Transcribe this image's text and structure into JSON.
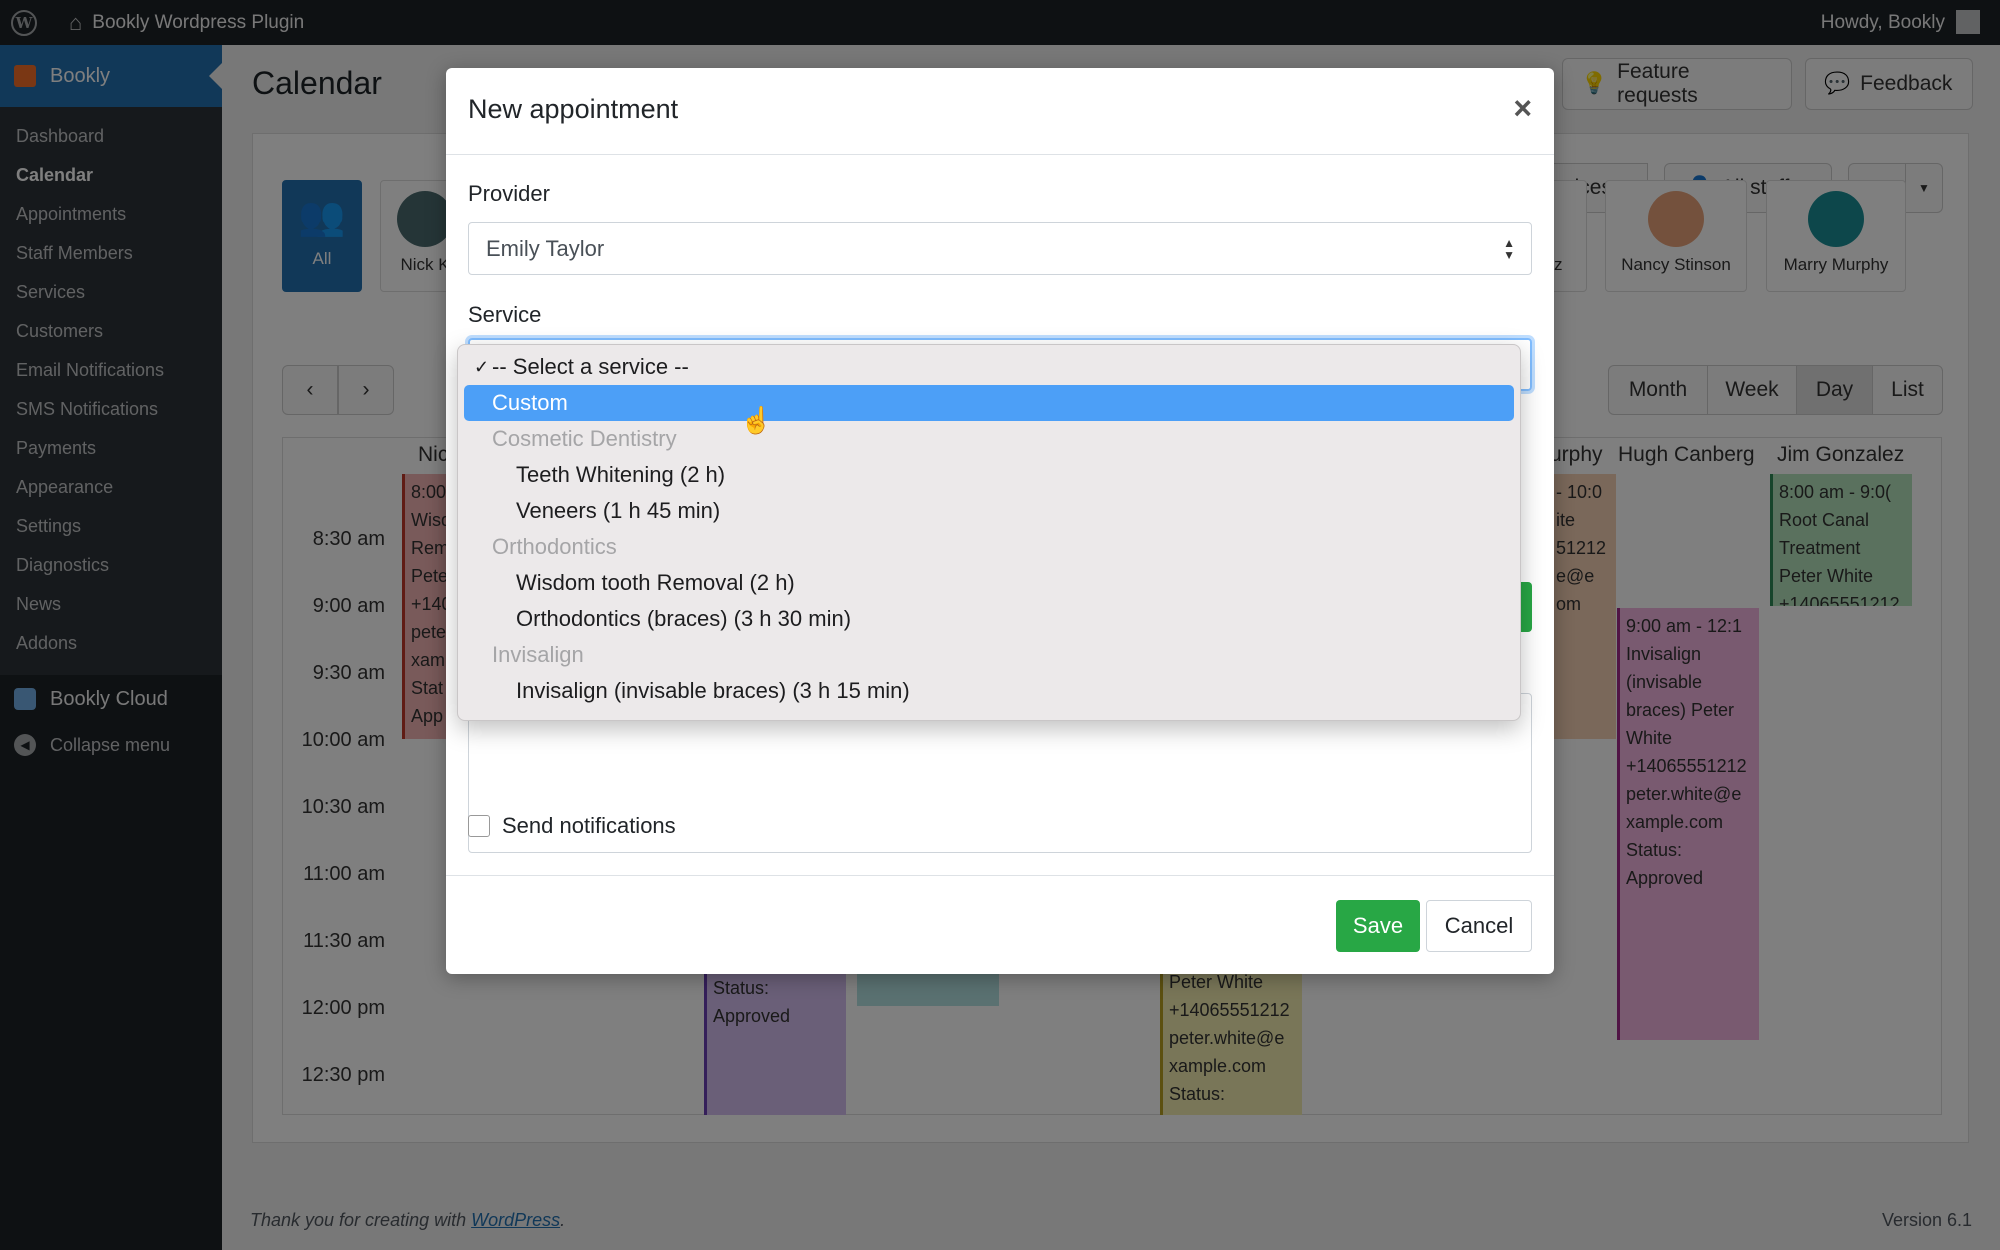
{
  "adminbar": {
    "site_name": "Bookly Wordpress Plugin",
    "howdy": "Howdy, Bookly"
  },
  "sidebar": {
    "current": "Bookly",
    "items": [
      "Dashboard",
      "Calendar",
      "Appointments",
      "Staff Members",
      "Services",
      "Customers",
      "Email Notifications",
      "SMS Notifications",
      "Payments",
      "Appearance",
      "Settings",
      "Diagnostics",
      "News",
      "Addons"
    ],
    "cloud": "Bookly Cloud",
    "collapse": "Collapse menu"
  },
  "page": {
    "title": "Calendar",
    "feature_requests": "Feature requests",
    "feedback": "Feedback",
    "services_filter": "vices",
    "staff_filter": "All staff",
    "views": [
      "Month",
      "Week",
      "Day",
      "List"
    ],
    "staff_all": "All",
    "staff_cards": [
      "Nick K",
      "ez",
      "Nancy Stinson",
      "Marry Murphy"
    ],
    "columns": [
      "Nic",
      "urphy",
      "Hugh Canberg",
      "Jim Gonzalez"
    ],
    "times": [
      "8:30 am",
      "9:00 am",
      "9:30 am",
      "10:00 am",
      "10:30 am",
      "11:00 am",
      "11:30 am",
      "12:00 pm",
      "12:30 pm"
    ],
    "events": {
      "e1": "8:00 Wisd Rem Pete +140 pete xam Stat App",
      "e2": "- 10:0 ite 51212 e@e om",
      "e3": "9:00 am - 12:1 Invisalign (invisable braces) Peter White +14065551212 peter.white@e xample.com Status: Approved",
      "e4": "8:00 am - 9:0( Root Canal Treatment Peter White +14065551212",
      "e5": "Status: Approved",
      "e6": "Peter White +14065551212 peter.white@e xample.com Status:"
    }
  },
  "modal": {
    "title": "New appointment",
    "provider_label": "Provider",
    "provider_value": "Emily Taylor",
    "service_label": "Service",
    "send_notifications": "Send notifications",
    "save": "Save",
    "cancel": "Cancel"
  },
  "dropdown": {
    "items": [
      {
        "label": "-- Select a service --",
        "type": "checked"
      },
      {
        "label": "Custom",
        "type": "selected"
      },
      {
        "label": "Cosmetic Dentistry",
        "type": "group"
      },
      {
        "label": "Teeth Whitening (2 h)",
        "type": "option"
      },
      {
        "label": "Veneers (1 h 45 min)",
        "type": "option"
      },
      {
        "label": "Orthodontics",
        "type": "group"
      },
      {
        "label": "Wisdom tooth Removal (2 h)",
        "type": "option"
      },
      {
        "label": "Orthodontics (braces) (3 h 30 min)",
        "type": "option"
      },
      {
        "label": "Invisalign",
        "type": "group"
      },
      {
        "label": "Invisalign (invisable braces) (3 h 15 min)",
        "type": "option"
      }
    ]
  },
  "footer": {
    "text": "Thank you for creating with ",
    "link": "WordPress",
    "period": ".",
    "version": "Version 6.1"
  }
}
